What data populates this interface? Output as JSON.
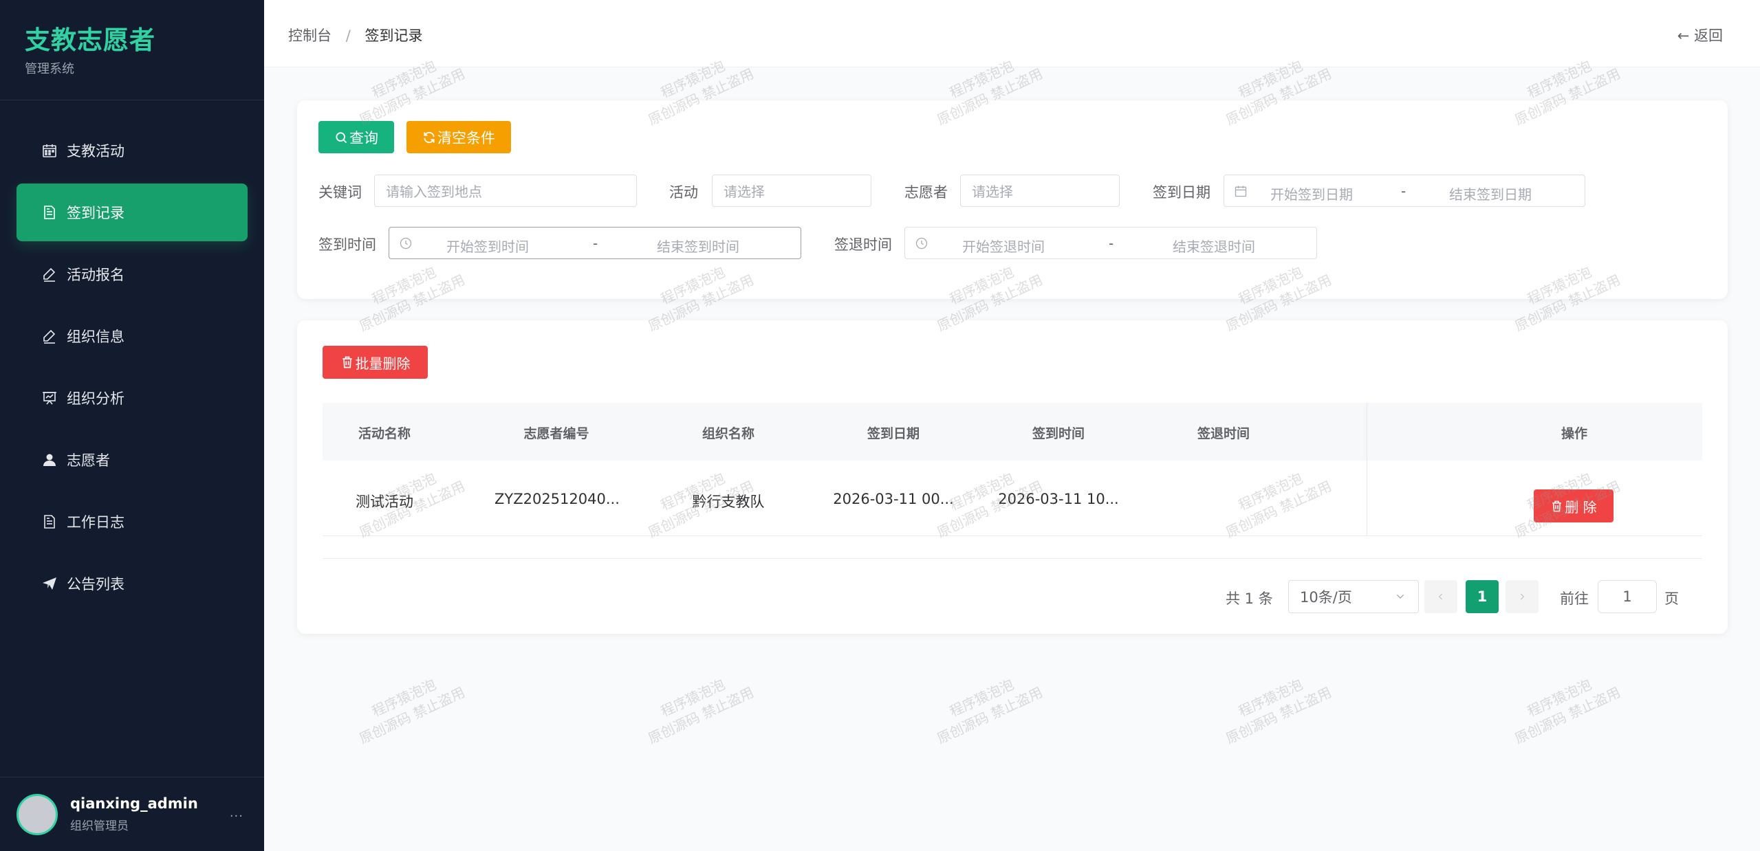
{
  "brand": {
    "title": "支教志愿者",
    "subtitle": "管理系统"
  },
  "sidebar": {
    "items": [
      {
        "label": "支教活动",
        "icon": "calendar-icon",
        "active": false
      },
      {
        "label": "签到记录",
        "icon": "document-icon",
        "active": true
      },
      {
        "label": "活动报名",
        "icon": "edit-icon",
        "active": false
      },
      {
        "label": "组织信息",
        "icon": "edit-icon",
        "active": false
      },
      {
        "label": "组织分析",
        "icon": "presentation-icon",
        "active": false
      },
      {
        "label": "志愿者",
        "icon": "user-icon",
        "active": false
      },
      {
        "label": "工作日志",
        "icon": "document-icon",
        "active": false
      },
      {
        "label": "公告列表",
        "icon": "send-icon",
        "active": false
      }
    ]
  },
  "user": {
    "name": "qianxing_admin",
    "role": "组织管理员",
    "more": "···"
  },
  "topbar": {
    "breadcrumb": [
      "控制台",
      "签到记录"
    ],
    "separator": "/",
    "back_label": "← 返回"
  },
  "filters": {
    "query_label": "查询",
    "clear_label": "清空条件",
    "keyword": {
      "label": "关键词",
      "placeholder": "请输入签到地点",
      "value": ""
    },
    "activity": {
      "label": "活动",
      "placeholder": "请选择",
      "value": ""
    },
    "volunteer": {
      "label": "志愿者",
      "placeholder": "请选择",
      "value": ""
    },
    "sign_date": {
      "label": "签到日期",
      "start_placeholder": "开始签到日期",
      "end_placeholder": "结束签到日期",
      "dash": "-"
    },
    "sign_time": {
      "label": "签到时间",
      "start_placeholder": "开始签到时间",
      "end_placeholder": "结束签到时间",
      "dash": "-"
    },
    "signout_time": {
      "label": "签退时间",
      "start_placeholder": "开始签退时间",
      "end_placeholder": "结束签退时间",
      "dash": "-"
    }
  },
  "table": {
    "batch_delete_label": "批量删除",
    "columns": [
      "活动名称",
      "志愿者编号",
      "组织名称",
      "签到日期",
      "签到时间",
      "签退时间",
      "操作"
    ],
    "rows": [
      {
        "activity": "测试活动",
        "volunteer_no": "ZYZ202512040...",
        "org": "黔行支教队",
        "sign_date": "2026-03-11 00...",
        "sign_time": "2026-03-11 10...",
        "signout_time": "",
        "delete_label": "删 除"
      }
    ]
  },
  "pagination": {
    "total_text": "共 1 条",
    "page_size": "10条/页",
    "current_page": "1",
    "goto_label": "前往",
    "goto_value": "1",
    "page_suffix": "页"
  },
  "watermark": {
    "line1": "程序猿泡泡",
    "line2": "原创源码 禁止盗用"
  }
}
